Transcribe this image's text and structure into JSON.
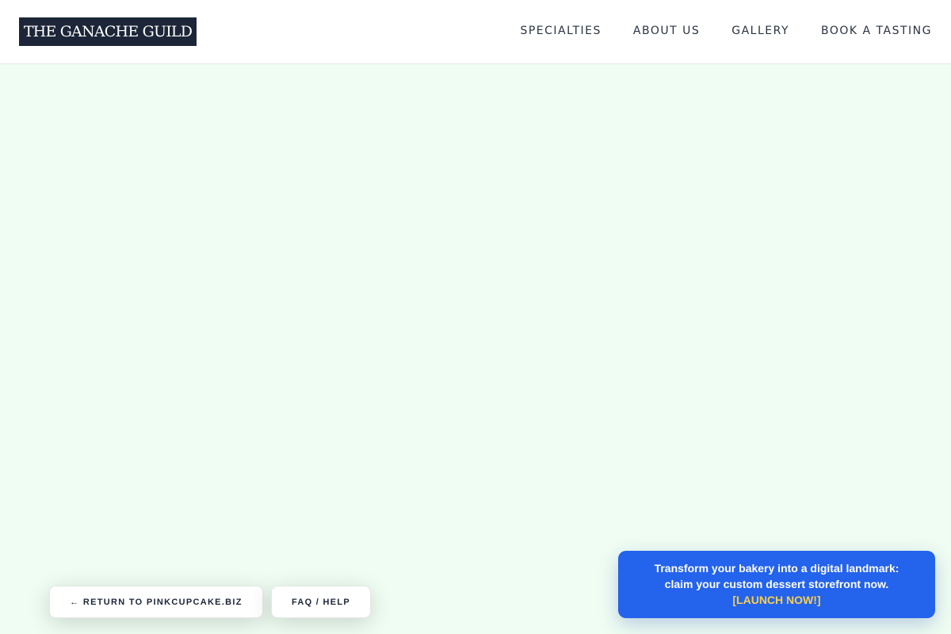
{
  "header": {
    "logo_text": "THE GANACHE GUILD",
    "nav": [
      {
        "label": "SPECIALTIES"
      },
      {
        "label": "ABOUT US"
      },
      {
        "label": "GALLERY"
      },
      {
        "label": "BOOK A TASTING"
      }
    ]
  },
  "footer_links": {
    "return_label": "← RETURN TO PINKCUPCAKE.BIZ",
    "faq_label": "FAQ / HELP"
  },
  "promo": {
    "line1": "Transform your bakery into a digital landmark:",
    "line2": "claim your custom dessert storefront now.",
    "cta": "[LAUNCH NOW!]"
  },
  "colors": {
    "page_background": "#effdf2",
    "logo_background": "#1c2638",
    "promo_background": "#2463eb",
    "promo_cta": "#fad14d"
  }
}
